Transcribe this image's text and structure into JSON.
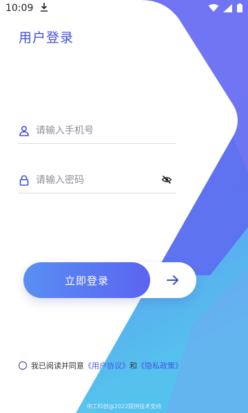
{
  "status_bar": {
    "time": "10:09"
  },
  "page": {
    "title": "用户登录"
  },
  "form": {
    "phone_placeholder": "请输入手机号",
    "password_placeholder": "请输入密码"
  },
  "actions": {
    "login_label": "立即登录"
  },
  "agreement": {
    "prefix": "我已阅读并同意",
    "user_agreement": "《用户协议》",
    "and": "和",
    "privacy_policy": "《隐私政策》"
  },
  "footer": {
    "text": "中工科创@2022提供技术支持"
  },
  "colors": {
    "accent": "#4150d4",
    "button_start": "#5a8ef4",
    "button_end": "#5a64f0",
    "link": "#4a54e0"
  },
  "icons": [
    "download-icon",
    "wifi-icon",
    "signal-icon",
    "battery-icon",
    "user-icon",
    "lock-icon",
    "eye-off-icon",
    "arrow-right-icon"
  ]
}
